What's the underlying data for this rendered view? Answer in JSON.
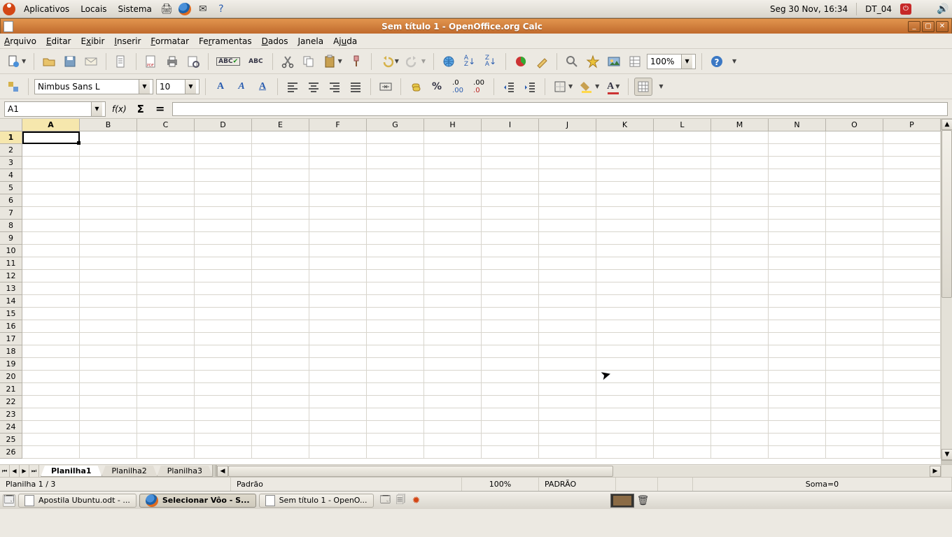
{
  "gnome": {
    "apps": "Aplicativos",
    "places": "Locais",
    "system": "Sistema",
    "clock": "Seg 30 Nov, 16:34",
    "user": "DT_04"
  },
  "window": {
    "title": "Sem título 1 - OpenOffice.org Calc"
  },
  "menus": [
    "Arquivo",
    "Editar",
    "Exibir",
    "Inserir",
    "Formatar",
    "Ferramentas",
    "Dados",
    "Janela",
    "Ajuda"
  ],
  "format": {
    "fontName": "Nimbus Sans L",
    "fontSize": "10",
    "zoom": "100%"
  },
  "formula": {
    "cellRef": "A1",
    "fx": "f(x)",
    "sigma": "Σ",
    "eq": "=",
    "value": ""
  },
  "columns": [
    "A",
    "B",
    "C",
    "D",
    "E",
    "F",
    "G",
    "H",
    "I",
    "J",
    "K",
    "L",
    "M",
    "N",
    "O",
    "P"
  ],
  "rowCount": 26,
  "tabs": [
    "Planilha1",
    "Planilha2",
    "Planilha3"
  ],
  "activeTab": 0,
  "status": {
    "sheet": "Planilha 1 / 3",
    "style": "Padrão",
    "zoom": "100%",
    "insert": "PADRÃO",
    "sum": "Soma=0"
  },
  "taskbar": [
    {
      "label": "Apostila Ubuntu.odt - ...",
      "icon": "doc"
    },
    {
      "label": "Selecionar Vôo - S...",
      "icon": "firefox",
      "active": true
    },
    {
      "label": "Sem título 1 - OpenO...",
      "icon": "doc"
    }
  ]
}
